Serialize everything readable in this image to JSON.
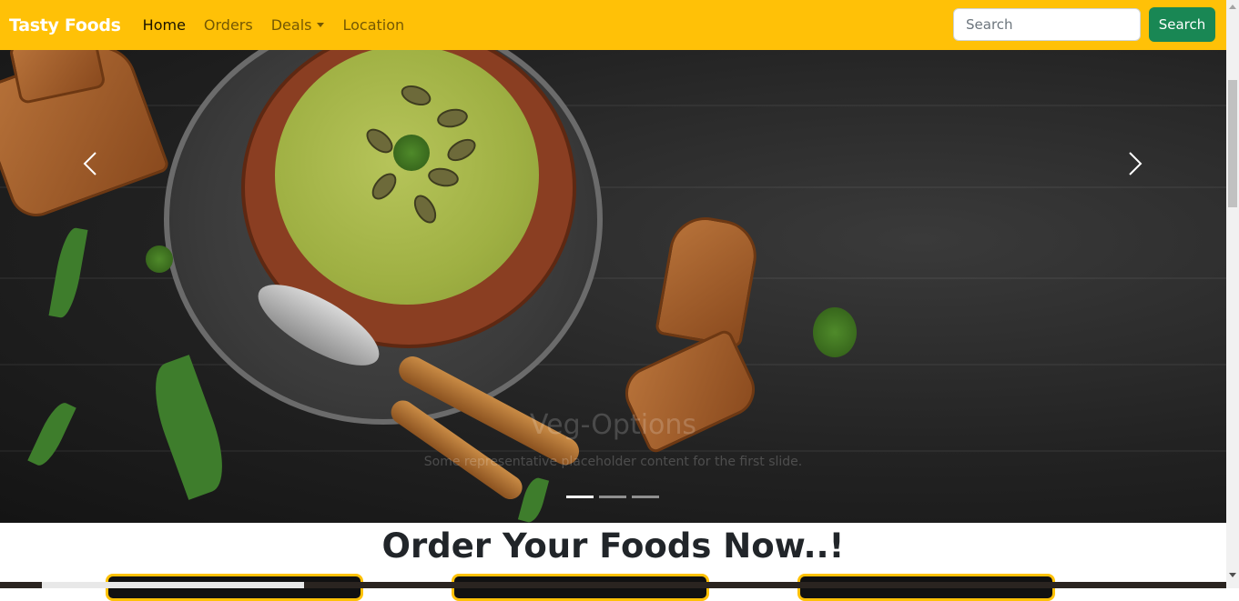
{
  "navbar": {
    "brand": "Tasty Foods",
    "links": [
      {
        "label": "Home",
        "active": true
      },
      {
        "label": "Orders",
        "active": false
      },
      {
        "label": "Deals",
        "active": false,
        "dropdown": true
      },
      {
        "label": "Location",
        "active": false
      }
    ],
    "search_placeholder": "Search",
    "search_button": "Search"
  },
  "carousel": {
    "slide_title": "Veg-Options",
    "slide_text": "Some representative placeholder content for the first slide.",
    "prev_icon": "chevron-left-icon",
    "next_icon": "chevron-right-icon",
    "indicator_count": 3,
    "active_indicator": 0
  },
  "main": {
    "heading": "Order Your Foods Now..!"
  },
  "colors": {
    "navbar_bg": "#ffc107",
    "brand_text": "#ffffff",
    "search_button_bg": "#198754",
    "card_border": "#ffc107"
  }
}
